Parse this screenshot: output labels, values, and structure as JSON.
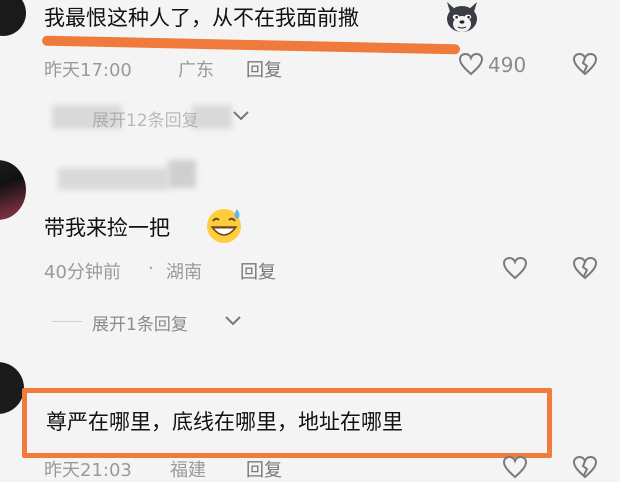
{
  "comments": [
    {
      "text": "我最恨这种人了，从不在我面前撒",
      "emoji": "wolf-emoji",
      "time": "昨天17:00",
      "location": "广东",
      "reply_label": "回复",
      "like_count": "490",
      "expand_label": "展开12条回复"
    },
    {
      "text": "带我来捡一把",
      "emoji": "sweat-grin-emoji",
      "time": "40分钟前",
      "location": "湖南",
      "separator": "·",
      "reply_label": "回复",
      "expand_label": "展开1条回复"
    },
    {
      "text": "尊严在哪里，底线在哪里，地址在哪里",
      "time": "昨天21:03",
      "location": "福建",
      "reply_label": "回复"
    }
  ],
  "colors": {
    "highlight_orange": "#f07a3c",
    "box_orange": "#ef7b3d",
    "meta_gray": "#9a9a9a"
  },
  "icons": [
    "heart-icon",
    "broken-heart-icon",
    "chevron-down-icon"
  ]
}
